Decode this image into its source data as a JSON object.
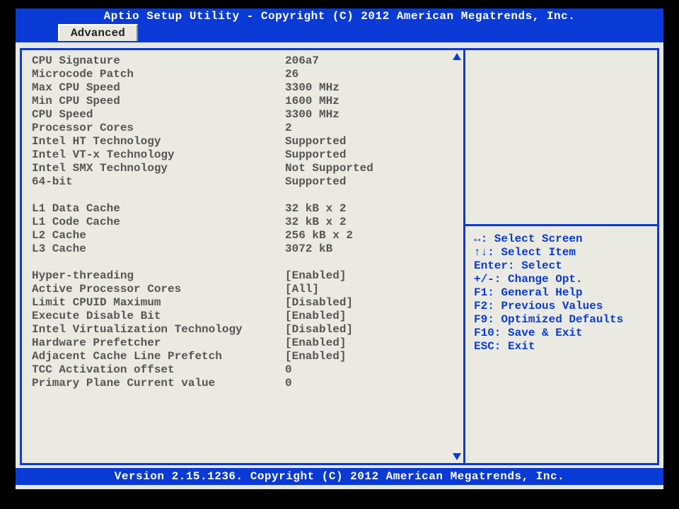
{
  "header": {
    "title": "Aptio Setup Utility - Copyright (C) 2012 American Megatrends, Inc.",
    "tab": "Advanced"
  },
  "footer": "Version 2.15.1236. Copyright (C) 2012 American Megatrends, Inc.",
  "info": [
    {
      "label": "CPU Signature",
      "value": "206a7"
    },
    {
      "label": "Microcode Patch",
      "value": "26"
    },
    {
      "label": "Max CPU Speed",
      "value": "3300 MHz"
    },
    {
      "label": "Min CPU Speed",
      "value": "1600 MHz"
    },
    {
      "label": "CPU Speed",
      "value": "3300 MHz"
    },
    {
      "label": "Processor Cores",
      "value": "2"
    },
    {
      "label": "Intel HT Technology",
      "value": "Supported"
    },
    {
      "label": "Intel VT-x Technology",
      "value": "Supported"
    },
    {
      "label": "Intel SMX Technology",
      "value": "Not Supported"
    },
    {
      "label": "64-bit",
      "value": "Supported"
    }
  ],
  "cache": [
    {
      "label": "L1 Data Cache",
      "value": "32 kB x 2"
    },
    {
      "label": "L1 Code Cache",
      "value": "32 kB x 2"
    },
    {
      "label": "L2 Cache",
      "value": "256 kB x 2"
    },
    {
      "label": "L3 Cache",
      "value": "3072 kB"
    }
  ],
  "settings": [
    {
      "label": "Hyper-threading",
      "value": "[Enabled]"
    },
    {
      "label": "Active Processor Cores",
      "value": "[All]"
    },
    {
      "label": "Limit CPUID Maximum",
      "value": "[Disabled]"
    },
    {
      "label": "Execute Disable Bit",
      "value": "[Enabled]"
    },
    {
      "label": "Intel Virtualization Technology",
      "value": "[Disabled]"
    },
    {
      "label": "Hardware Prefetcher",
      "value": "[Enabled]"
    },
    {
      "label": "Adjacent Cache Line Prefetch",
      "value": "[Enabled]"
    },
    {
      "label": "TCC Activation offset",
      "value": "0"
    },
    {
      "label": "Primary Plane Current value",
      "value": "0"
    }
  ],
  "help": {
    "l1": "↔: Select Screen",
    "l2": "↑↓: Select Item",
    "l3": "Enter: Select",
    "l4": "+/-: Change Opt.",
    "l5": "F1: General Help",
    "l6": "F2: Previous Values",
    "l7": "F9: Optimized Defaults",
    "l8": "F10: Save & Exit",
    "l9": "ESC: Exit"
  }
}
